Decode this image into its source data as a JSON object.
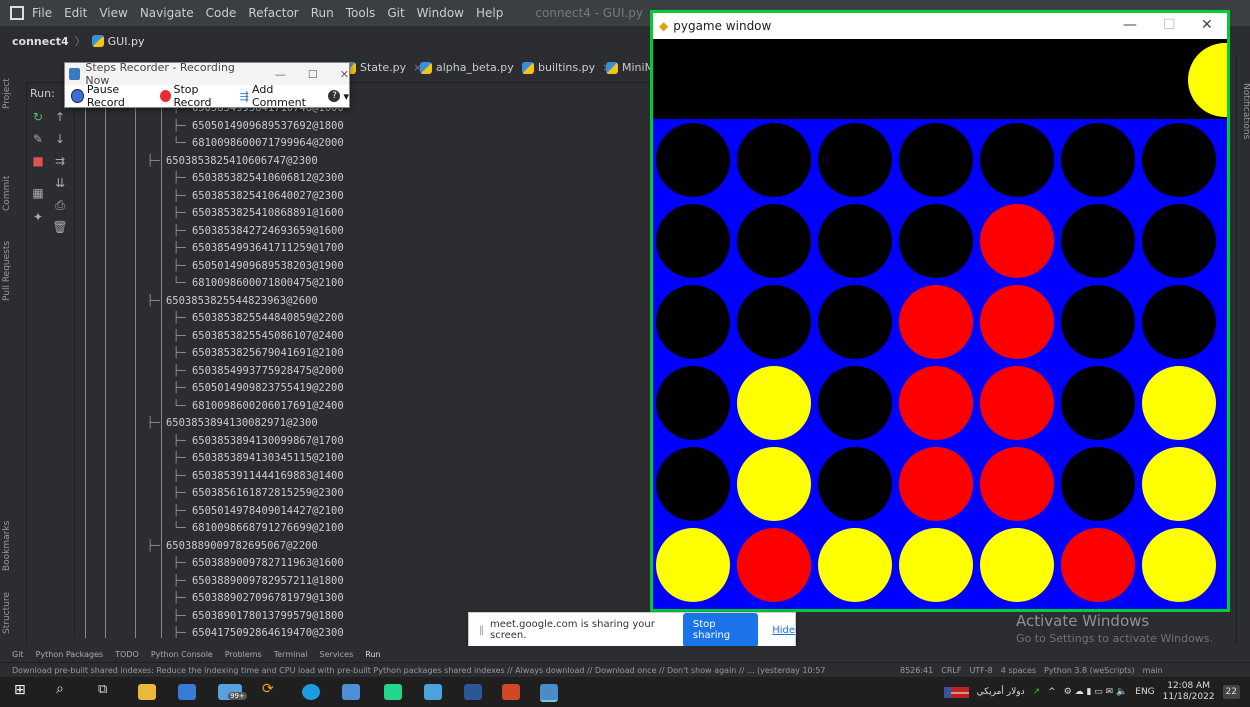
{
  "ide": {
    "menu": [
      "File",
      "Edit",
      "View",
      "Navigate",
      "Code",
      "Refactor",
      "Run",
      "Tools",
      "Git",
      "Window",
      "Help"
    ],
    "window_title": "connect4 - GUI.py",
    "project": "connect4",
    "file": "GUI.py",
    "tabs": [
      "State.py",
      "alpha_beta.py",
      "builtins.py",
      "MiniM"
    ],
    "run_label": "Run:",
    "left_tabs": [
      "Project",
      "Commit",
      "Pull Requests",
      "Bookmarks",
      "Structure"
    ],
    "right_tab": "Notifications"
  },
  "console_lines": [
    {
      "indent": 3,
      "branch": "├─",
      "text": "6503854993641710748@1600"
    },
    {
      "indent": 3,
      "branch": "├─",
      "text": "6505014909689537692@1800"
    },
    {
      "indent": 3,
      "branch": "└─",
      "text": "6810098600071799964@2000"
    },
    {
      "indent": 2,
      "branch": "├─",
      "text": "6503853825410606747@2300"
    },
    {
      "indent": 3,
      "branch": "├─",
      "text": "6503853825410606812@2300"
    },
    {
      "indent": 3,
      "branch": "├─",
      "text": "6503853825410640027@2300"
    },
    {
      "indent": 3,
      "branch": "├─",
      "text": "6503853825410868891@1600"
    },
    {
      "indent": 3,
      "branch": "├─",
      "text": "6503853842724693659@1600"
    },
    {
      "indent": 3,
      "branch": "├─",
      "text": "6503854993641711259@1700"
    },
    {
      "indent": 3,
      "branch": "├─",
      "text": "6505014909689538203@1900"
    },
    {
      "indent": 3,
      "branch": "└─",
      "text": "6810098600071800475@2100"
    },
    {
      "indent": 2,
      "branch": "├─",
      "text": "6503853825544823963@2600"
    },
    {
      "indent": 3,
      "branch": "├─",
      "text": "6503853825544840859@2200"
    },
    {
      "indent": 3,
      "branch": "├─",
      "text": "6503853825545086107@2400"
    },
    {
      "indent": 3,
      "branch": "├─",
      "text": "6503853825679041691@2100"
    },
    {
      "indent": 3,
      "branch": "├─",
      "text": "6503854993775928475@2000"
    },
    {
      "indent": 3,
      "branch": "├─",
      "text": "6505014909823755419@2200"
    },
    {
      "indent": 3,
      "branch": "└─",
      "text": "6810098600206017691@2400"
    },
    {
      "indent": 2,
      "branch": "├─",
      "text": "6503853894130082971@2300"
    },
    {
      "indent": 3,
      "branch": "├─",
      "text": "6503853894130099867@1700"
    },
    {
      "indent": 3,
      "branch": "├─",
      "text": "6503853894130345115@2100"
    },
    {
      "indent": 3,
      "branch": "├─",
      "text": "6503853911444169883@1400"
    },
    {
      "indent": 3,
      "branch": "├─",
      "text": "6503856161872815259@2300"
    },
    {
      "indent": 3,
      "branch": "├─",
      "text": "6505014978409014427@2100"
    },
    {
      "indent": 3,
      "branch": "└─",
      "text": "6810098668791276699@2100"
    },
    {
      "indent": 2,
      "branch": "├─",
      "text": "6503889009782695067@2200"
    },
    {
      "indent": 3,
      "branch": "├─",
      "text": "6503889009782711963@1600"
    },
    {
      "indent": 3,
      "branch": "├─",
      "text": "6503889009782957211@1800"
    },
    {
      "indent": 3,
      "branch": "├─",
      "text": "6503889027096781979@1300"
    },
    {
      "indent": 3,
      "branch": "├─",
      "text": "6503890178013799579@1800"
    },
    {
      "indent": 3,
      "branch": "├─",
      "text": "6504175092864619470@2300"
    }
  ],
  "steps_recorder": {
    "title": "Steps Recorder - Recording Now",
    "pause": "Pause Record",
    "stop": "Stop Record",
    "comment": "Add Comment"
  },
  "pygame": {
    "title": "pygame window",
    "board": [
      [
        "empty",
        "empty",
        "empty",
        "empty",
        "empty",
        "empty",
        "empty"
      ],
      [
        "empty",
        "empty",
        "empty",
        "empty",
        "red",
        "empty",
        "empty"
      ],
      [
        "empty",
        "empty",
        "empty",
        "red",
        "red",
        "empty",
        "empty"
      ],
      [
        "empty",
        "yellow",
        "empty",
        "red",
        "red",
        "empty",
        "yellow"
      ],
      [
        "empty",
        "yellow",
        "empty",
        "red",
        "red",
        "empty",
        "yellow"
      ],
      [
        "yellow",
        "red",
        "yellow",
        "yellow",
        "yellow",
        "red",
        "yellow"
      ]
    ],
    "colors": {
      "board": "#0000ff",
      "empty": "#000000",
      "red": "#ff0000",
      "yellow": "#ffff00",
      "border": "#00cc33"
    }
  },
  "share": {
    "text": "meet.google.com is sharing your screen.",
    "stop": "Stop sharing",
    "hide": "Hide"
  },
  "watermark": {
    "line1": "Activate Windows",
    "line2": "Go to Settings to activate Windows."
  },
  "bottom_tabs": [
    "Git",
    "Python Packages",
    "TODO",
    "Python Console",
    "Problems",
    "Terminal",
    "Services",
    "Run"
  ],
  "status": {
    "message": "Download pre-built shared indexes: Reduce the indexing time and CPU load with pre-built Python packages shared indexes // Always download // Download once // Don't show again // ... (yesterday 10:57",
    "position": "8526:41",
    "line_sep": "CRLF",
    "encoding": "UTF-8",
    "indent": "4 spaces",
    "interpreter": "Python 3.8 (weScripts)",
    "branch": "main"
  },
  "taskbar": {
    "currency": "دولار أمريكي",
    "lang": "ENG",
    "time": "12:08 AM",
    "date": "11/18/2022",
    "notif": "22",
    "badge": "99+"
  }
}
